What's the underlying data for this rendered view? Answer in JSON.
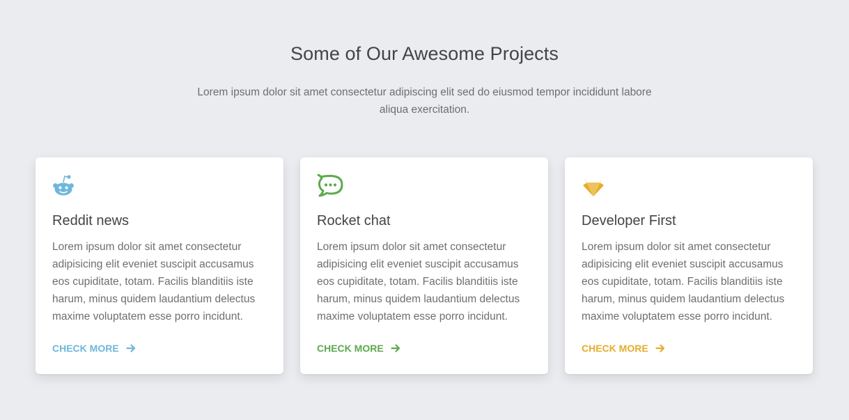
{
  "section": {
    "title": "Some of Our Awesome Projects",
    "subtitle": "Lorem ipsum dolor sit amet consectetur adipiscing elit sed do eiusmod tempor incididunt labore aliqua exercitation."
  },
  "cards": [
    {
      "icon": "reddit-icon",
      "title": "Reddit news",
      "text": "Lorem ipsum dolor sit amet consectetur adipisicing elit eveniet suscipit accusamus eos cupiditate, totam. Facilis blanditiis iste harum, minus quidem laudantium delectus maxime voluptatem esse porro incidunt.",
      "link": "CHECK MORE",
      "color": "#6fb7db"
    },
    {
      "icon": "rocket-chat-icon",
      "title": "Rocket chat",
      "text": "Lorem ipsum dolor sit amet consectetur adipisicing elit eveniet suscipit accusamus eos cupiditate, totam. Facilis blanditiis iste harum, minus quidem laudantium delectus maxime voluptatem esse porro incidunt.",
      "link": "CHECK MORE",
      "color": "#5ca94d"
    },
    {
      "icon": "gitlab-icon",
      "title": "Developer First",
      "text": "Lorem ipsum dolor sit amet consectetur adipisicing elit eveniet suscipit accusamus eos cupiditate, totam. Facilis blanditiis iste harum, minus quidem laudantium delectus maxime voluptatem esse porro incidunt.",
      "link": "CHECK MORE",
      "color": "#e5ad2c"
    }
  ]
}
